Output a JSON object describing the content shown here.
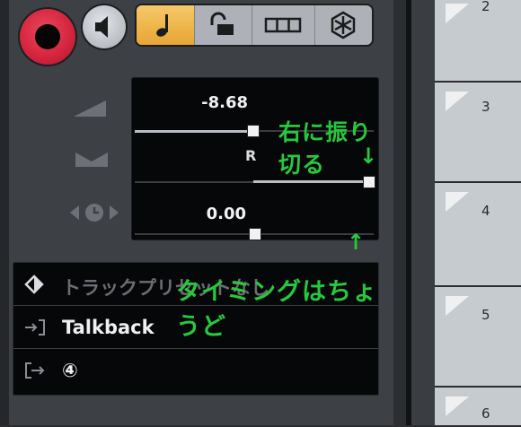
{
  "pan": {
    "value": "-8.68",
    "mode_letter": "R"
  },
  "delay": {
    "value": "0.00"
  },
  "preset": {
    "label": "トラックプリセットなし"
  },
  "input": {
    "label": "Talkback"
  },
  "output": {
    "label": "④"
  },
  "tracks": [
    "2",
    "3",
    "4",
    "5",
    "6"
  ],
  "annotations": {
    "top": "右に振り切る",
    "arrow_down": "↓",
    "arrow_up": "↑",
    "bottom": "タイミングはちょうど"
  },
  "colors": {
    "panel": "#3d4044",
    "record": "#d6263f",
    "active_button": "#f0b44c",
    "annotation": "#28c83c",
    "tracks": "#c6cbd0"
  },
  "icons": [
    "record-icon",
    "speaker-icon",
    "note-icon",
    "lock-icon",
    "grid-icon",
    "snowflake-icon",
    "volume-ramp-icon",
    "bowtie-icon",
    "delay-icon",
    "preset-diamond-icon",
    "input-icon",
    "output-icon",
    "track-flag-icon"
  ]
}
